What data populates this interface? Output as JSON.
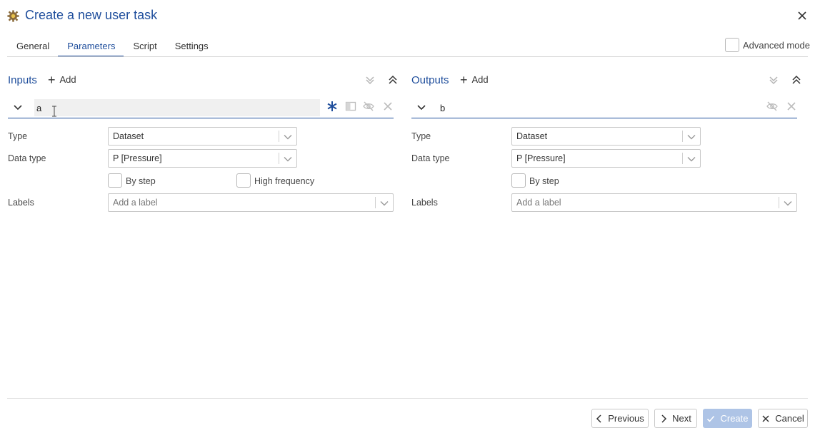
{
  "dialog": {
    "title": "Create a new user task",
    "icons": {
      "title_icon": "gear-icon",
      "close": "close-icon"
    }
  },
  "tabs": [
    {
      "label": "General",
      "active": false
    },
    {
      "label": "Parameters",
      "active": true
    },
    {
      "label": "Script",
      "active": false
    },
    {
      "label": "Settings",
      "active": false
    }
  ],
  "advanced_mode": {
    "label": "Advanced mode",
    "checked": false
  },
  "inputs": {
    "title": "Inputs",
    "add_label": "Add",
    "param": {
      "name": "a",
      "type_label": "Type",
      "type_value": "Dataset",
      "data_type_label": "Data type",
      "data_type_value": "P [Pressure]",
      "by_step_label": "By step",
      "high_frequency_label": "High frequency",
      "labels_label": "Labels",
      "labels_placeholder": "Add a label"
    }
  },
  "outputs": {
    "title": "Outputs",
    "add_label": "Add",
    "param": {
      "name": "b",
      "type_label": "Type",
      "type_value": "Dataset",
      "data_type_label": "Data type",
      "data_type_value": "P [Pressure]",
      "by_step_label": "By step",
      "labels_label": "Labels",
      "labels_placeholder": "Add a label"
    }
  },
  "footer": {
    "previous_label": "Previous",
    "next_label": "Next",
    "create_label": "Create",
    "cancel_label": "Cancel"
  },
  "colors": {
    "accent": "#1f4e9c",
    "primary_disabled": "#aec4e6",
    "border": "#c8c8c8"
  }
}
